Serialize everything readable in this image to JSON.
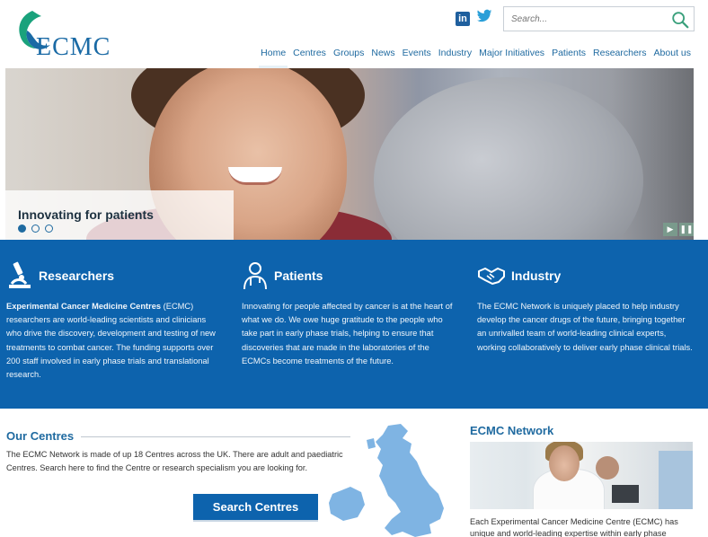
{
  "header": {
    "logo_text": "ECMC",
    "search_placeholder": "Search...",
    "social": [
      "linkedin-icon",
      "twitter-icon"
    ]
  },
  "nav": {
    "items": [
      "Home",
      "Centres",
      "Groups",
      "News",
      "Events",
      "Industry",
      "Major Initiatives",
      "Patients",
      "Researchers",
      "About us"
    ],
    "active": "Home"
  },
  "hero": {
    "caption": "Innovating for patients",
    "slides": 3,
    "active_slide": 1
  },
  "columns": [
    {
      "icon": "microscope-icon",
      "title": "Researchers",
      "lead_bold": "Experimental Cancer Medicine Centres",
      "text": " (ECMC) researchers are world-leading scientists and clinicians who drive the discovery, development and testing of new treatments to combat cancer. The funding supports over 200 staff involved in early phase trials and translational research."
    },
    {
      "icon": "doctor-icon",
      "title": "Patients",
      "text": "Innovating for people affected by cancer is at the heart of what we do. We owe huge gratitude to the people who take part in early phase trials, helping to ensure that discoveries that are made in the laboratories of the ECMCs become treatments of the future."
    },
    {
      "icon": "handshake-icon",
      "title": "Industry",
      "text": "The ECMC Network is uniquely placed to help industry develop the cancer drugs of the future, bringing together an unrivalled team of world-leading clinical experts, working collaboratively to deliver early phase clinical trials."
    }
  ],
  "centres": {
    "title": "Our Centres",
    "text": "The ECMC Network is made of up 18 Centres across the UK. There are adult and paediatric Centres. Search here to find the Centre or research specialism you are looking for.",
    "button": "Search Centres"
  },
  "network": {
    "title": "ECMC Network",
    "text": "Each Experimental Cancer Medicine Centre (ECMC) has unique and world-leading expertise within early phase"
  },
  "colors": {
    "brand_blue": "#0d63ad",
    "link_blue": "#1f6aa0",
    "logo_teal": "#1aa27c"
  }
}
